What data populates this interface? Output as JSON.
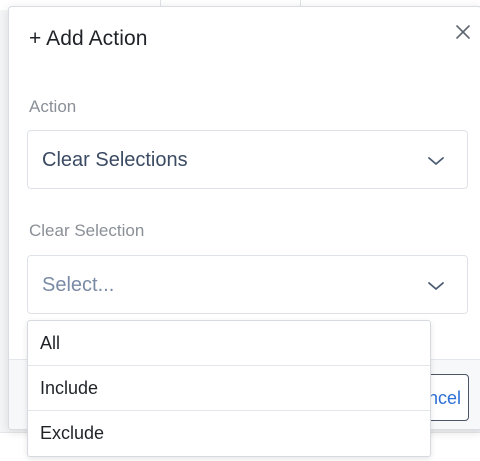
{
  "modal": {
    "title": "+ Add Action",
    "close_icon": "close-icon",
    "action_field": {
      "label": "Action",
      "value": "Clear Selections"
    },
    "clear_selection_field": {
      "label": "Clear Selection",
      "placeholder": "Select..."
    },
    "footer": {
      "cancel_label": "Cancel"
    }
  },
  "dropdown": {
    "options": [
      {
        "label": "All"
      },
      {
        "label": "Include"
      },
      {
        "label": "Exclude"
      }
    ]
  },
  "colors": {
    "title_text": "#1f2328",
    "label_text": "#8a9097",
    "select_value_text": "#3b4b63",
    "placeholder_text": "#7a8ba6",
    "chevron": "#4a5b73",
    "cancel_text": "#2c6fd6"
  }
}
